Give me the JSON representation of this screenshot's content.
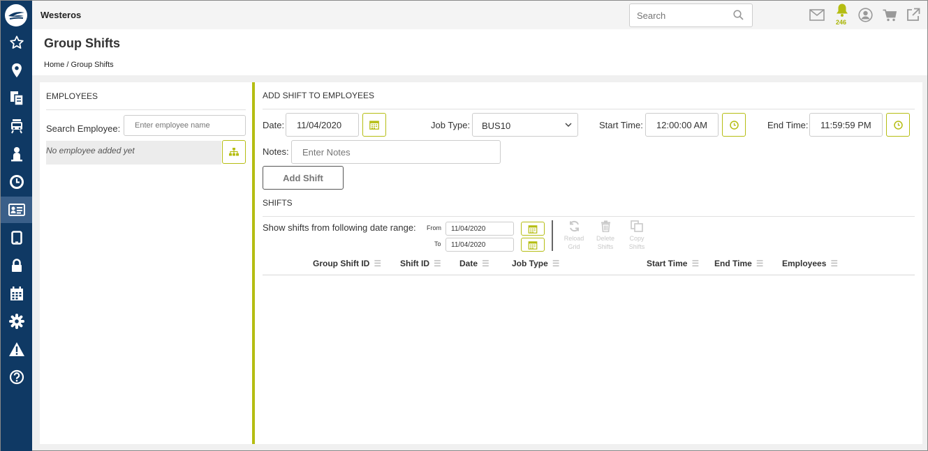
{
  "app": {
    "title": "Westeros"
  },
  "topbar": {
    "search_placeholder": "Search",
    "notification_count": "246"
  },
  "header": {
    "page_title": "Group Shifts",
    "breadcrumb": [
      "Home",
      "/",
      "Group Shifts"
    ]
  },
  "colors": {
    "accent": "#b5bd12",
    "sidebar": "#0f3964",
    "sidebar_active": "#3a5f89"
  },
  "sidebar": {
    "items": [
      "star-icon",
      "map-pin-icon",
      "documents-icon",
      "bus-icon",
      "person-icon",
      "clock-icon",
      "id-card-icon",
      "tablet-icon",
      "lock-icon",
      "calendar-icon",
      "gear-icon",
      "warning-icon",
      "help-icon"
    ],
    "active": "id-card-icon"
  },
  "employees": {
    "title": "EMPLOYEES",
    "search_label": "Search Employee:",
    "search_placeholder": "Enter employee name",
    "empty_text": "No employee added yet"
  },
  "add_shift": {
    "title": "ADD SHIFT TO EMPLOYEES",
    "date_label": "Date:",
    "date_value": "11/04/2020",
    "job_type_label": "Job Type:",
    "job_type_value": "BUS10",
    "start_time_label": "Start Time:",
    "start_time_value": "12:00:00 AM",
    "end_time_label": "End Time:",
    "end_time_value": "11:59:59 PM",
    "notes_label": "Notes:",
    "notes_placeholder": "Enter Notes",
    "add_button": "Add Shift"
  },
  "shifts": {
    "title": "SHIFTS",
    "range_label": "Show shifts from following date range:",
    "from_label": "From",
    "from_value": "11/04/2020",
    "to_label": "To",
    "to_value": "11/04/2020",
    "tools": {
      "reload": [
        "Reload",
        "Grid"
      ],
      "delete": [
        "Delete",
        "Shifts"
      ],
      "copy": [
        "Copy",
        "Shifts"
      ]
    },
    "columns": [
      "Group Shift ID",
      "Shift ID",
      "Date",
      "Job Type",
      "Start Time",
      "End Time",
      "Employees"
    ]
  }
}
